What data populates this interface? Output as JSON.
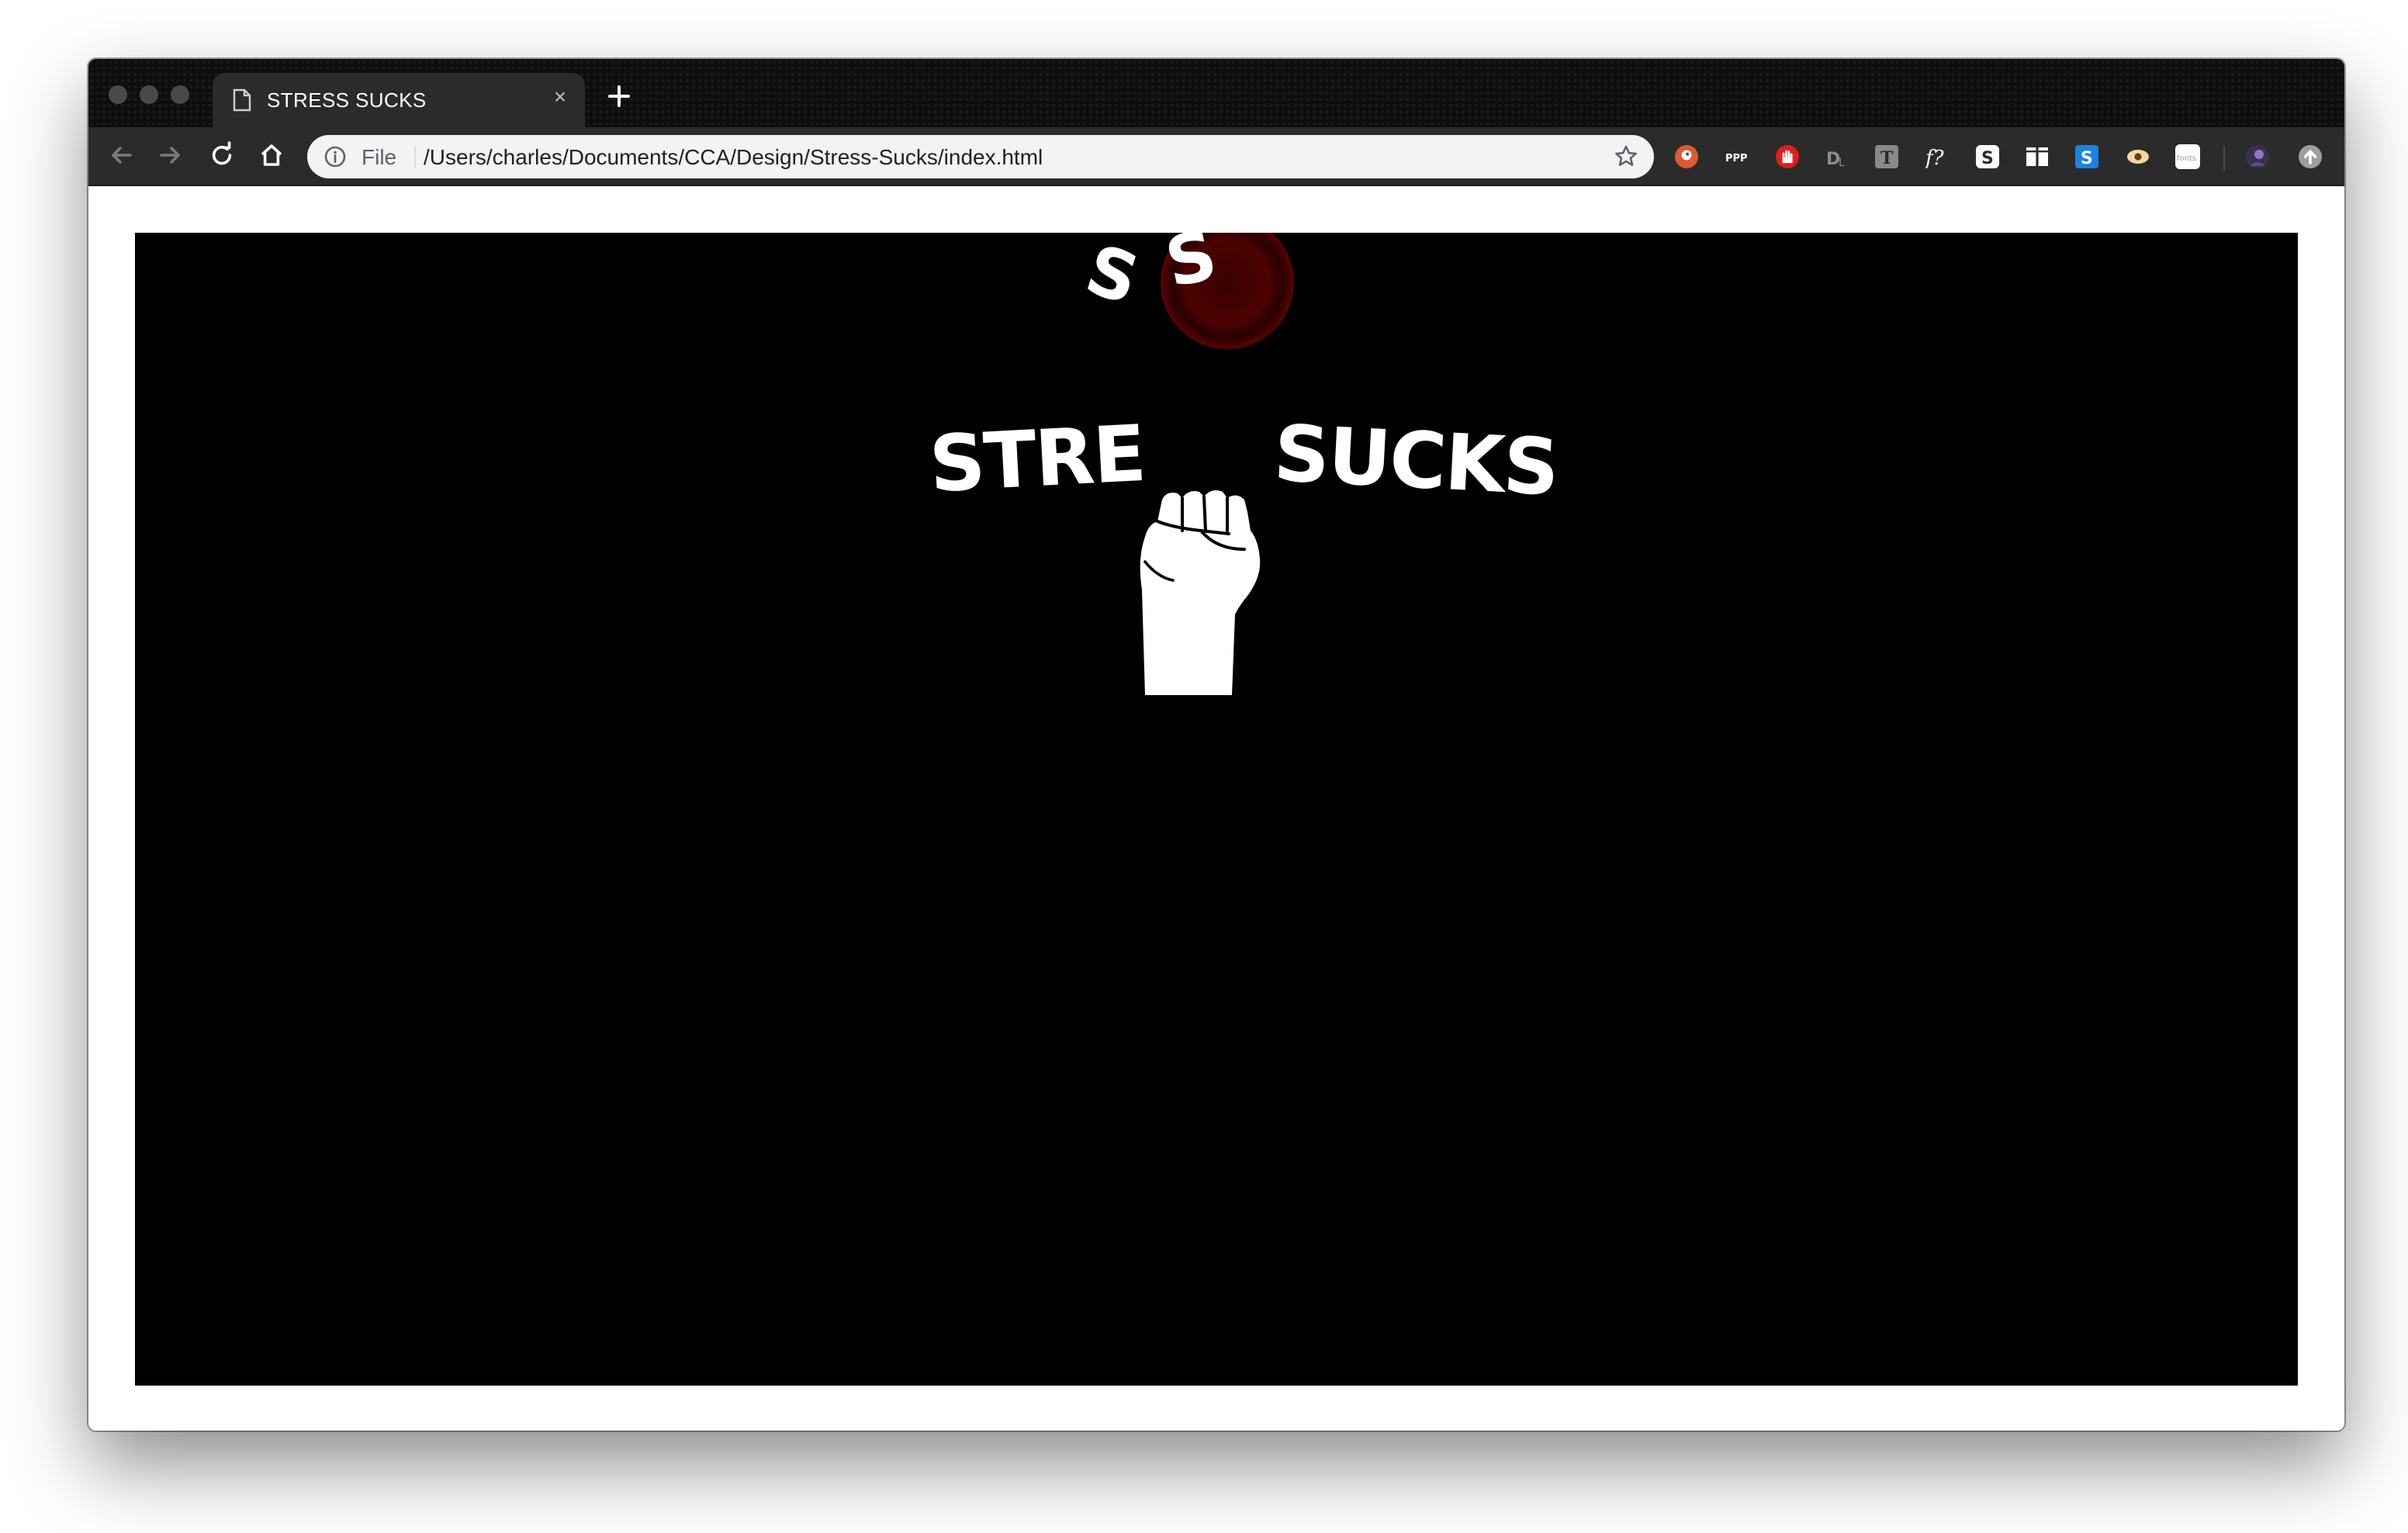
{
  "browser": {
    "tab": {
      "title": "STRESS SUCKS",
      "close_glyph": "×",
      "icon": "document-icon"
    },
    "new_tab_icon": "plus-icon",
    "toolbar": {
      "back_icon": "arrow-left-icon",
      "forward_icon": "arrow-right-icon",
      "reload_icon": "reload-icon",
      "home_icon": "home-icon"
    },
    "address_bar": {
      "scheme_label": "File",
      "url": "/Users/charles/Documents/CCA/Design/Stress-Sucks/index.html",
      "info_icon": "info-icon",
      "bookmark_icon": "star-icon"
    },
    "extensions": [
      {
        "name": "duckduckgo-extension-icon",
        "color": "#de5833"
      },
      {
        "name": "ppp-extension-icon",
        "label": "PPP",
        "color": "#2b2b2b"
      },
      {
        "name": "hand-stop-extension-icon",
        "color": "#e0201b"
      },
      {
        "name": "dl-extension-icon",
        "label": "DL",
        "color": "#2b2b2b"
      },
      {
        "name": "t-extension-icon",
        "label": "T",
        "color": "#8a8a8a"
      },
      {
        "name": "whatfont-extension-icon",
        "label": "f?",
        "color": "#2b2b2b"
      },
      {
        "name": "s-extension-icon",
        "label": "S",
        "color": "#ffffff"
      },
      {
        "name": "columns-extension-icon",
        "color": "#ffffff"
      },
      {
        "name": "blue-s-extension-icon",
        "label": "S",
        "color": "#1a82e2"
      },
      {
        "name": "eye-extension-icon",
        "color": "#f2d9a0"
      },
      {
        "name": "fonts-extension-icon",
        "label": "fonts",
        "color": "#ffffff"
      },
      {
        "name": "profile-avatar-icon",
        "color": "#5a4a8a"
      },
      {
        "name": "update-icon",
        "color": "#9e9e9e"
      }
    ]
  },
  "page": {
    "background": "#000000",
    "letters": {
      "floating_s": "S",
      "button_s": "S"
    },
    "title_left": "STRE",
    "title_right": "SUCKS",
    "button_color": "#b51f1f",
    "fist_icon": "raised-fist-icon"
  }
}
